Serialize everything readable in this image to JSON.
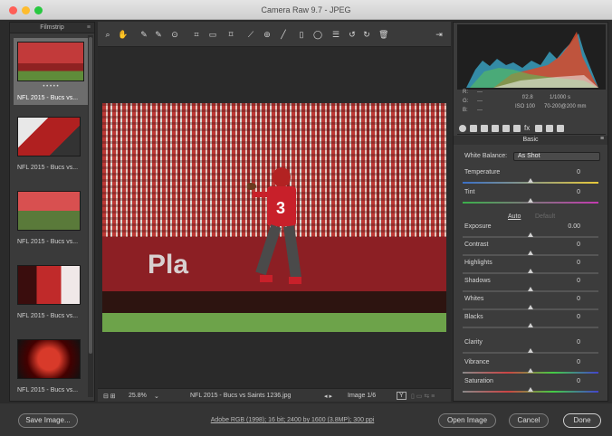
{
  "window": {
    "title": "Camera Raw 9.7  -  JPEG"
  },
  "filmstrip": {
    "header": "Filmstrip",
    "items": [
      {
        "caption": "NFL 2015 - Bucs vs...",
        "selected": true
      },
      {
        "caption": "NFL 2015 - Bucs vs..."
      },
      {
        "caption": "NFL 2015 - Bucs vs..."
      },
      {
        "caption": "NFL 2015 - Bucs vs..."
      },
      {
        "caption": "NFL 2015 - Bucs vs..."
      }
    ]
  },
  "toolbar": {
    "tools": [
      "zoom-icon",
      "hand-icon",
      "eyedropper-icon",
      "color-sampler-icon",
      "target-adjust-icon",
      "crop-icon",
      "straighten-icon",
      "transform-icon",
      "spot-removal-icon",
      "red-eye-icon",
      "adjustment-brush-icon",
      "graduated-filter-icon",
      "radial-filter-icon",
      "preferences-icon",
      "rotate-ccw-icon",
      "rotate-cw-icon",
      "trash-icon"
    ]
  },
  "status": {
    "zoom": "25.8%",
    "filename": "NFL 2015 - Bucs vs Saints 1236.jpg",
    "image_count": "Image 1/6"
  },
  "histogram": {
    "rgb_labels": {
      "r": "R:",
      "g": "G:",
      "b": "B:",
      "empty": "---"
    },
    "aperture": "f/2.8",
    "shutter": "1/1000 s",
    "iso": "ISO 100",
    "lens": "70-200@200 mm"
  },
  "basic": {
    "title": "Basic",
    "white_balance_label": "White Balance:",
    "white_balance_value": "As Shot",
    "auto": "Auto",
    "default": "Default",
    "sliders": [
      {
        "label": "Temperature",
        "value": "0",
        "pos": 0.5
      },
      {
        "label": "Tint",
        "value": "0",
        "pos": 0.5
      },
      {
        "label": "Exposure",
        "value": "0.00",
        "pos": 0.5
      },
      {
        "label": "Contrast",
        "value": "0",
        "pos": 0.5
      },
      {
        "label": "Highlights",
        "value": "0",
        "pos": 0.5
      },
      {
        "label": "Shadows",
        "value": "0",
        "pos": 0.5
      },
      {
        "label": "Whites",
        "value": "0",
        "pos": 0.5
      },
      {
        "label": "Blacks",
        "value": "0",
        "pos": 0.5
      },
      {
        "label": "Clarity",
        "value": "0",
        "pos": 0.5
      },
      {
        "label": "Vibrance",
        "value": "0",
        "pos": 0.5
      },
      {
        "label": "Saturation",
        "value": "0",
        "pos": 0.5
      }
    ]
  },
  "footer": {
    "save_image": "Save Image...",
    "workflow_link": "Adobe RGB (1998); 16 bit; 2400 by 1600 (3.8MP); 300 ppi",
    "open_image": "Open Image",
    "cancel": "Cancel",
    "done": "Done"
  },
  "photo": {
    "banner": "Pla"
  }
}
